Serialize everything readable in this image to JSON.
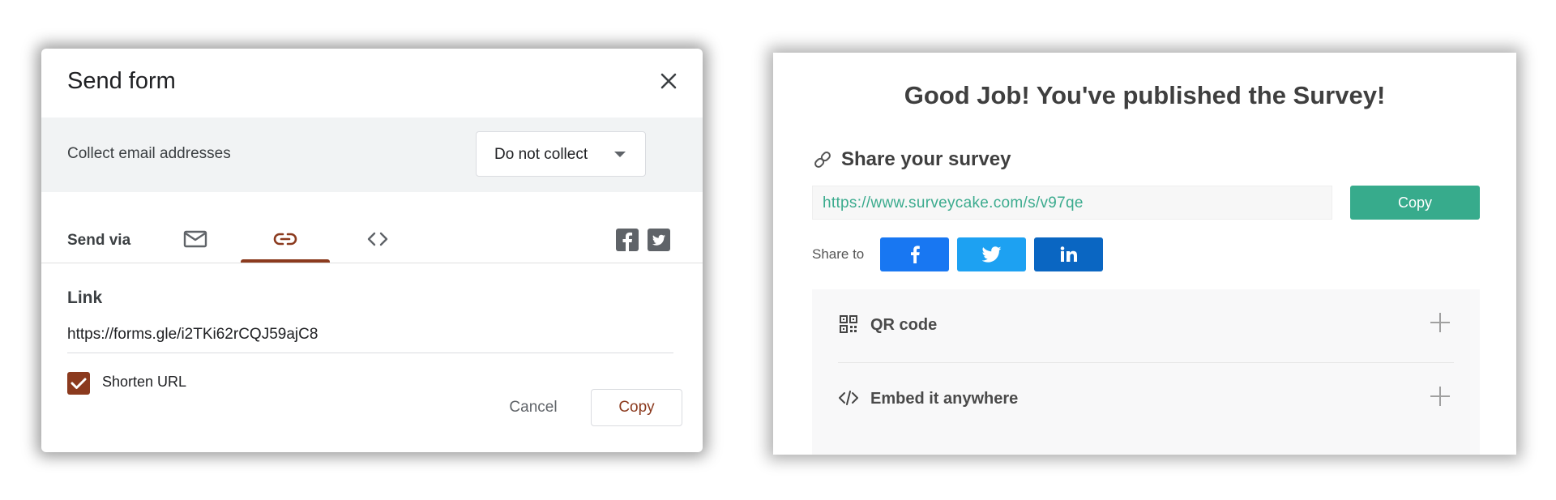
{
  "send_form": {
    "title": "Send form",
    "collect_label": "Collect email addresses",
    "collect_value": "Do not collect",
    "send_via_label": "Send via",
    "tabs": [
      {
        "icon": "envelope-icon",
        "active": false
      },
      {
        "icon": "link-icon",
        "active": true
      },
      {
        "icon": "embed-code-icon",
        "active": false
      }
    ],
    "social": [
      "facebook-icon",
      "twitter-icon"
    ],
    "link_heading": "Link",
    "link_value": "https://forms.gle/i2TKi62rCQJ59ajC8",
    "shorten_label": "Shorten URL",
    "shorten_checked": true,
    "cancel_label": "Cancel",
    "copy_label": "Copy",
    "accent_color": "#8b3a1e"
  },
  "survey_panel": {
    "title": "Good Job! You've published the Survey!",
    "share_heading": "Share your survey",
    "url_value": "https://www.surveycake.com/s/v97qe",
    "copy_label": "Copy",
    "share_to_label": "Share to",
    "social_buttons": [
      {
        "icon": "facebook-icon",
        "color": "#1877f2"
      },
      {
        "icon": "twitter-icon",
        "color": "#1da1f2"
      },
      {
        "icon": "linkedin-icon",
        "color": "#0a66c2"
      }
    ],
    "accordion": [
      {
        "icon": "qr-code-icon",
        "label": "QR code"
      },
      {
        "icon": "embed-code-icon",
        "label": "Embed it anywhere"
      }
    ],
    "accent_color": "#37ab8c"
  }
}
